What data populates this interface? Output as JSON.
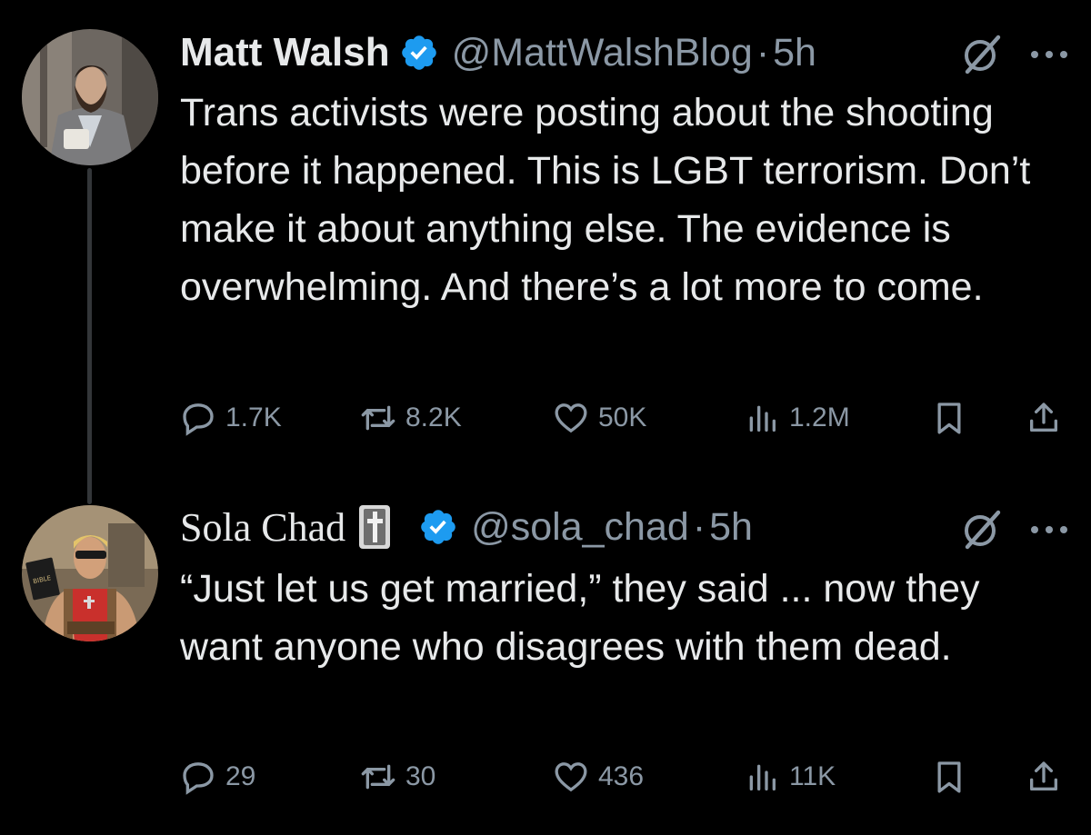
{
  "tweets": [
    {
      "author": "Matt Walsh",
      "handle": "@MattWalshBlog",
      "separator": "·",
      "time": "5h",
      "verified": true,
      "text": "Trans activists were posting about the shooting before it happened. This is LGBT terrorism. Don’t make it about anything else. The evidence is overwhelming. And there’s a lot more to come.",
      "replies": "1.7K",
      "reposts": "8.2K",
      "likes": "50K",
      "views": "1.2M"
    },
    {
      "author": "Sola Chad",
      "handle": "@sola_chad",
      "separator": "·",
      "time": "5h",
      "verified": true,
      "text": "“Just let us get married,” they said ... now they want anyone who disagrees with them dead.",
      "replies": "29",
      "reposts": "30",
      "likes": "436",
      "views": "11K"
    }
  ],
  "colors": {
    "background": "#000000",
    "text": "#e7e9ea",
    "muted": "#8b98a5",
    "verified": "#1d9bf0",
    "thread_line": "#333639"
  },
  "icons": [
    "verified-badge-icon",
    "grok-icon",
    "more-icon",
    "reply-icon",
    "repost-icon",
    "like-icon",
    "views-icon",
    "bookmark-icon",
    "share-icon",
    "cross-emoji-icon"
  ]
}
